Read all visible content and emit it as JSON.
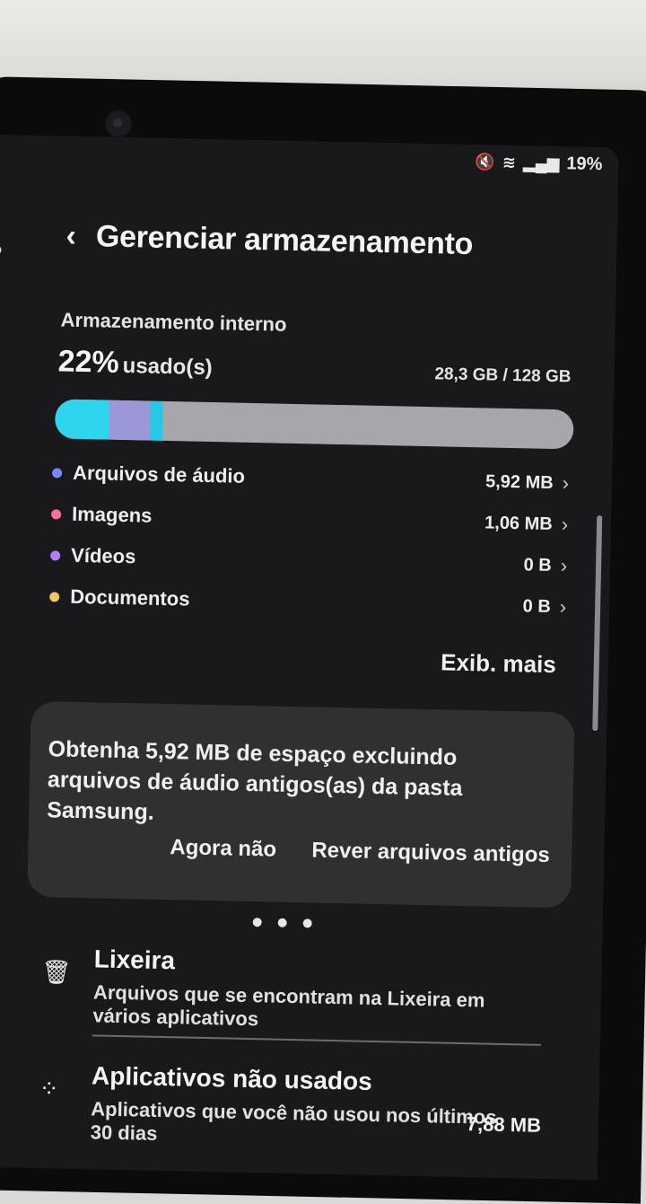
{
  "status": {
    "mute_icon": "mute-icon",
    "wifi_icon": "wifi-icon",
    "signal_icon": "signal-icon",
    "battery": "19%"
  },
  "header": {
    "back_icon": "back-icon",
    "title": "Gerenciar armazenamento"
  },
  "storage": {
    "label": "Armazenamento interno",
    "percent": "22%",
    "percent_suffix": "usado(s)",
    "used_total": "28,3 GB / 128 GB",
    "usage_fraction": 0.22
  },
  "categories": [
    {
      "name": "Arquivos de áudio",
      "size": "5,92 MB",
      "color": "#7a86ff"
    },
    {
      "name": "Imagens",
      "size": "1,06 MB",
      "color": "#ff6f9a"
    },
    {
      "name": "Vídeos",
      "size": "0 B",
      "color": "#b57cff"
    },
    {
      "name": "Documentos",
      "size": "0 B",
      "color": "#f2c46b"
    }
  ],
  "show_more": "Exib. mais",
  "suggestion": {
    "text": "Obtenha 5,92 MB de espaço excluindo arquivos de áudio antigos(as) da pasta Samsung.",
    "not_now": "Agora não",
    "review": "Rever arquivos antigos"
  },
  "items": [
    {
      "icon": "trash-icon",
      "title": "Lixeira",
      "subtitle": "Arquivos que se encontram na Lixeira em vários aplicativos"
    },
    {
      "icon": "apps-icon",
      "title": "Aplicativos não usados",
      "subtitle": "Aplicativos que você não usou nos últimos 30 dias",
      "value": "7,88 MB"
    }
  ],
  "colors": {
    "bar_track": "#a6a6ab",
    "bar_primary": "#2fd4ee",
    "bar_secondary": "#9b97d8",
    "screen_bg": "#19191b",
    "card_bg": "#303033"
  }
}
